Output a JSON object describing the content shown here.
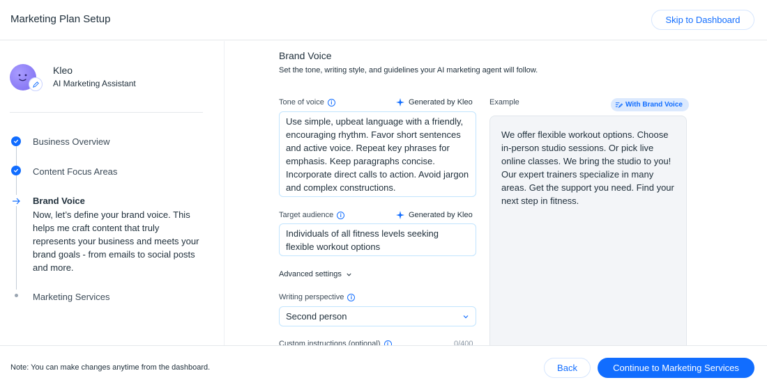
{
  "header": {
    "title": "Marketing Plan Setup",
    "skip_label": "Skip to Dashboard"
  },
  "assistant": {
    "name": "Kleo",
    "role": "AI Marketing Assistant"
  },
  "steps": [
    {
      "label": "Business Overview",
      "status": "done"
    },
    {
      "label": "Content Focus Areas",
      "status": "done"
    },
    {
      "label": "Brand Voice",
      "status": "current",
      "description": "Now, let’s define your brand voice. This helps me craft content that truly represents your business and meets your brand goals - from emails to social posts and more."
    },
    {
      "label": "Marketing Services",
      "status": "upcoming"
    }
  ],
  "main": {
    "title": "Brand Voice",
    "subtitle": "Set the tone, writing style, and guidelines your AI marketing agent will follow.",
    "tone": {
      "label": "Tone of voice",
      "generated": "Generated by Kleo",
      "value": "Use simple, upbeat language with a friendly, encouraging rhythm. Favor short sentences and active voice. Repeat key phrases for emphasis. Keep paragraphs concise. Incorporate direct calls to action. Avoid jargon and complex constructions."
    },
    "audience": {
      "label": "Target audience",
      "generated": "Generated by Kleo",
      "value": "Individuals of all fitness levels seeking flexible workout options"
    },
    "advanced_label": "Advanced settings",
    "perspective": {
      "label": "Writing perspective",
      "value": "Second person"
    },
    "custom": {
      "label": "Custom instructions (optional)",
      "counter": "0/400"
    },
    "example": {
      "label": "Example",
      "badge": "With Brand Voice",
      "text": "We offer flexible workout options. Choose in-person studio sessions. Or pick live online classes. We bring the studio to you! Our expert trainers specialize in many areas. Get the support you need. Find your next step in fitness."
    }
  },
  "footer": {
    "note": "Note: You can make changes anytime from the dashboard.",
    "back_label": "Back",
    "continue_label": "Continue to Marketing Services"
  },
  "colors": {
    "accent": "#116dff",
    "text": "#20303c",
    "avatar": "#8b7cf6"
  }
}
